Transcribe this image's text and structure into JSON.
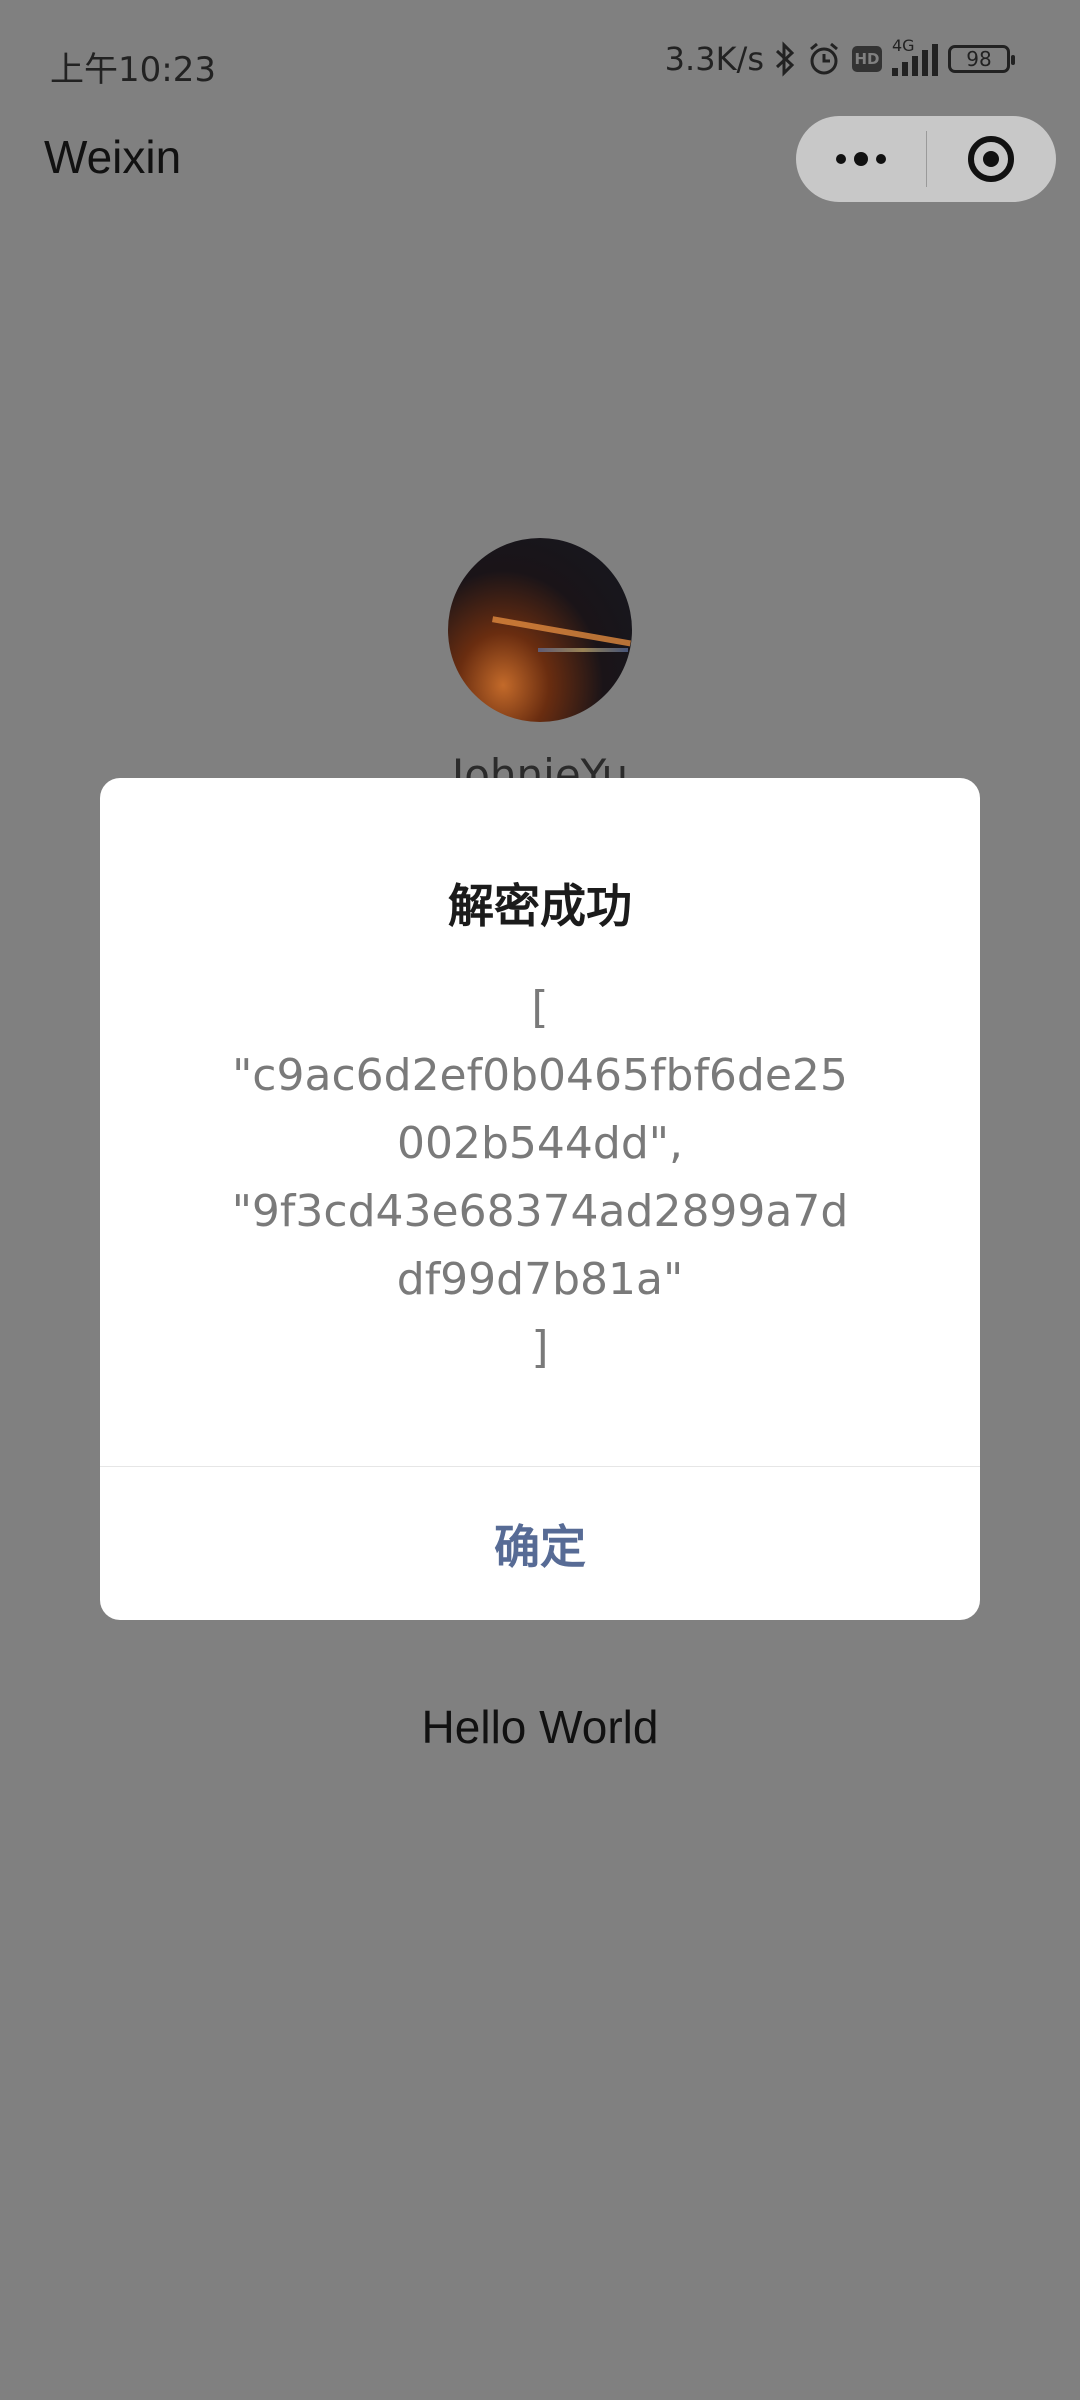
{
  "status_bar": {
    "time": "上午10:23",
    "net_speed": "3.3K/s",
    "hd": "HD",
    "network": "4G",
    "battery": "98"
  },
  "nav": {
    "title": "Weixin"
  },
  "page": {
    "username": "JohnieYu",
    "hello": "Hello World"
  },
  "modal": {
    "title": "解密成功",
    "content": "[\n\"c9ac6d2ef0b0465fbf6de25002b544dd\",\n\"9f3cd43e68374ad2899a7ddf99d7b81a\"\n]",
    "confirm_label": "确定"
  },
  "colors": {
    "overlay_background": "#808080",
    "modal_background": "#ffffff",
    "confirm_text": "#576b95"
  }
}
